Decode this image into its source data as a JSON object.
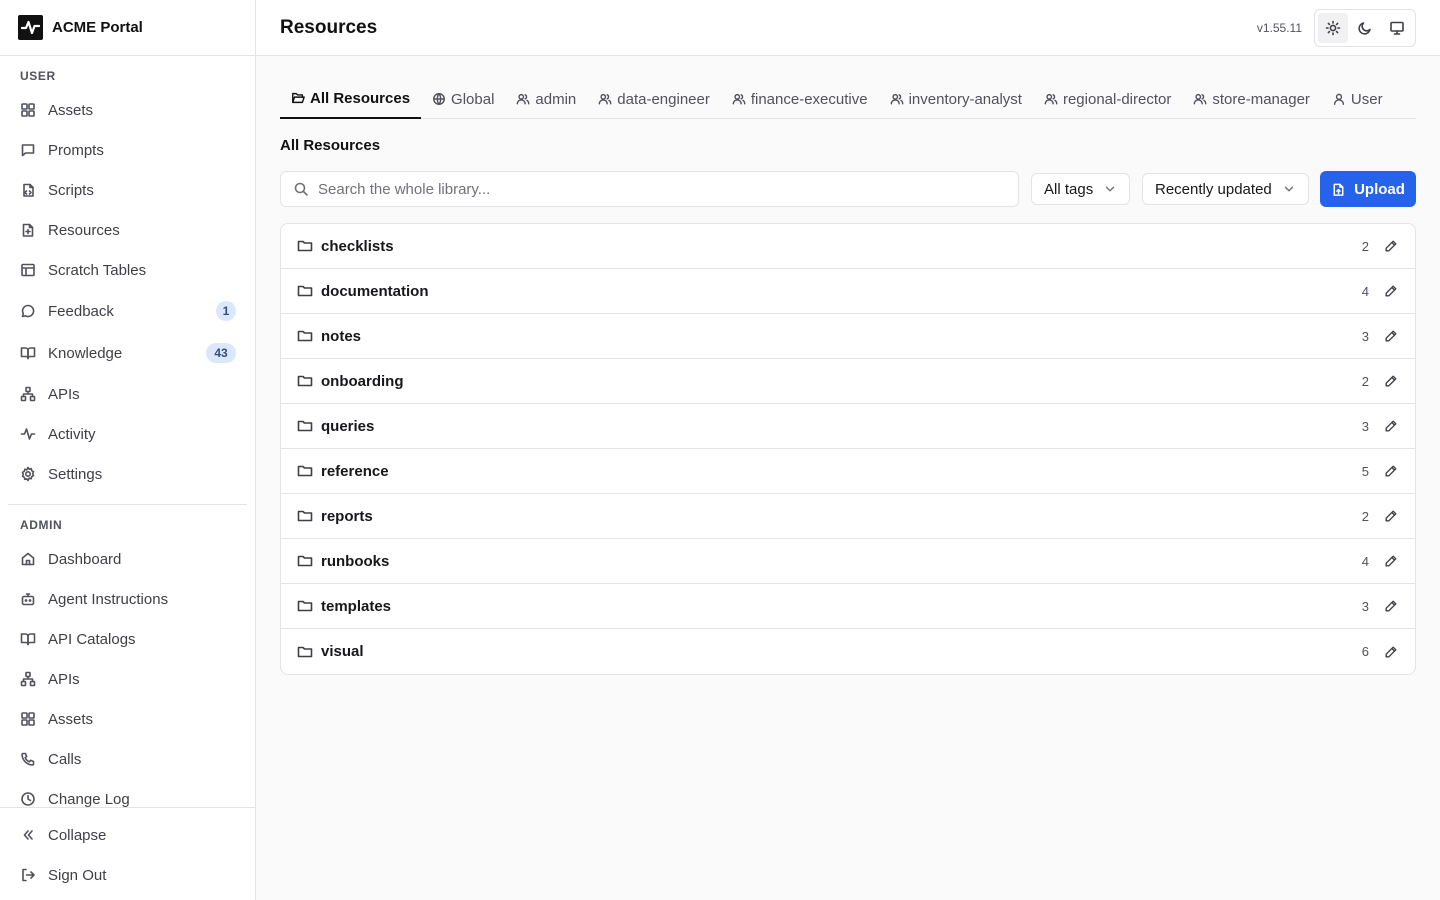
{
  "brand": {
    "name": "ACME Portal"
  },
  "sidebar": {
    "user_label": "USER",
    "user_items": [
      {
        "label": "Assets",
        "icon": "grid-icon"
      },
      {
        "label": "Prompts",
        "icon": "message-square-icon"
      },
      {
        "label": "Scripts",
        "icon": "file-code-icon"
      },
      {
        "label": "Resources",
        "icon": "file-plus-icon"
      },
      {
        "label": "Scratch Tables",
        "icon": "table-icon"
      },
      {
        "label": "Feedback",
        "icon": "message-circle-icon",
        "badge": "1"
      },
      {
        "label": "Knowledge",
        "icon": "book-open-icon",
        "badge": "43"
      },
      {
        "label": "APIs",
        "icon": "network-icon"
      },
      {
        "label": "Activity",
        "icon": "activity-icon"
      },
      {
        "label": "Settings",
        "icon": "gear-icon"
      }
    ],
    "admin_label": "ADMIN",
    "admin_items": [
      {
        "label": "Dashboard",
        "icon": "home-icon"
      },
      {
        "label": "Agent Instructions",
        "icon": "bot-icon"
      },
      {
        "label": "API Catalogs",
        "icon": "book-open-icon"
      },
      {
        "label": "APIs",
        "icon": "network-icon"
      },
      {
        "label": "Assets",
        "icon": "grid-icon"
      },
      {
        "label": "Calls",
        "icon": "phone-icon"
      },
      {
        "label": "Change Log",
        "icon": "clock-icon"
      }
    ],
    "footer": {
      "collapse": "Collapse",
      "sign_out": "Sign Out"
    }
  },
  "header": {
    "title": "Resources",
    "version": "v1.55.11"
  },
  "tabs": [
    {
      "label": "All Resources",
      "icon": "folder-open-icon",
      "active": true
    },
    {
      "label": "Global",
      "icon": "globe-icon"
    },
    {
      "label": "admin",
      "icon": "users-icon"
    },
    {
      "label": "data-engineer",
      "icon": "users-icon"
    },
    {
      "label": "finance-executive",
      "icon": "users-icon"
    },
    {
      "label": "inventory-analyst",
      "icon": "users-icon"
    },
    {
      "label": "regional-director",
      "icon": "users-icon"
    },
    {
      "label": "store-manager",
      "icon": "users-icon"
    },
    {
      "label": "User",
      "icon": "user-icon"
    }
  ],
  "section_title": "All Resources",
  "toolbar": {
    "search_placeholder": "Search the whole library...",
    "tags_filter": "All tags",
    "sort": "Recently updated",
    "upload_label": "Upload"
  },
  "folders": [
    {
      "name": "checklists",
      "count": "2"
    },
    {
      "name": "documentation",
      "count": "4"
    },
    {
      "name": "notes",
      "count": "3"
    },
    {
      "name": "onboarding",
      "count": "2"
    },
    {
      "name": "queries",
      "count": "3"
    },
    {
      "name": "reference",
      "count": "5"
    },
    {
      "name": "reports",
      "count": "2"
    },
    {
      "name": "runbooks",
      "count": "4"
    },
    {
      "name": "templates",
      "count": "3"
    },
    {
      "name": "visual",
      "count": "6"
    }
  ],
  "colors": {
    "primary": "#2563eb",
    "badge_bg": "#dbe7fb",
    "badge_text": "#2f4f86"
  }
}
